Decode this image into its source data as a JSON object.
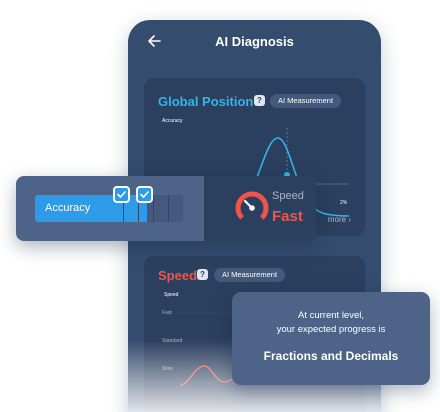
{
  "header": {
    "title": "AI Diagnosis",
    "back_icon": "back-arrow-icon"
  },
  "global_position": {
    "title": "Global Position",
    "pill": "AI Measurement",
    "chart_label": "Accuracy",
    "percent_label": "2%",
    "more": "more"
  },
  "accuracy_panel": {
    "label": "Accuracy",
    "level_filled": 3,
    "level_total": 5,
    "speed_label": "Speed",
    "speed_value": "Fast"
  },
  "speed_card": {
    "title": "Speed",
    "pill": "AI Measurement",
    "chart_label": "Speed",
    "tick_1": "Fast",
    "tick_2": "Standard",
    "tick_3": "Slow"
  },
  "progress": {
    "line1": "At current level,",
    "line2": "your expected progress is",
    "topic": "Fractions and Decimals"
  },
  "colors": {
    "accent_blue": "#2fb6ea",
    "accent_red": "#f0554b",
    "card_bg": "#2b3f5e",
    "panel_bg": "#4d6387"
  }
}
